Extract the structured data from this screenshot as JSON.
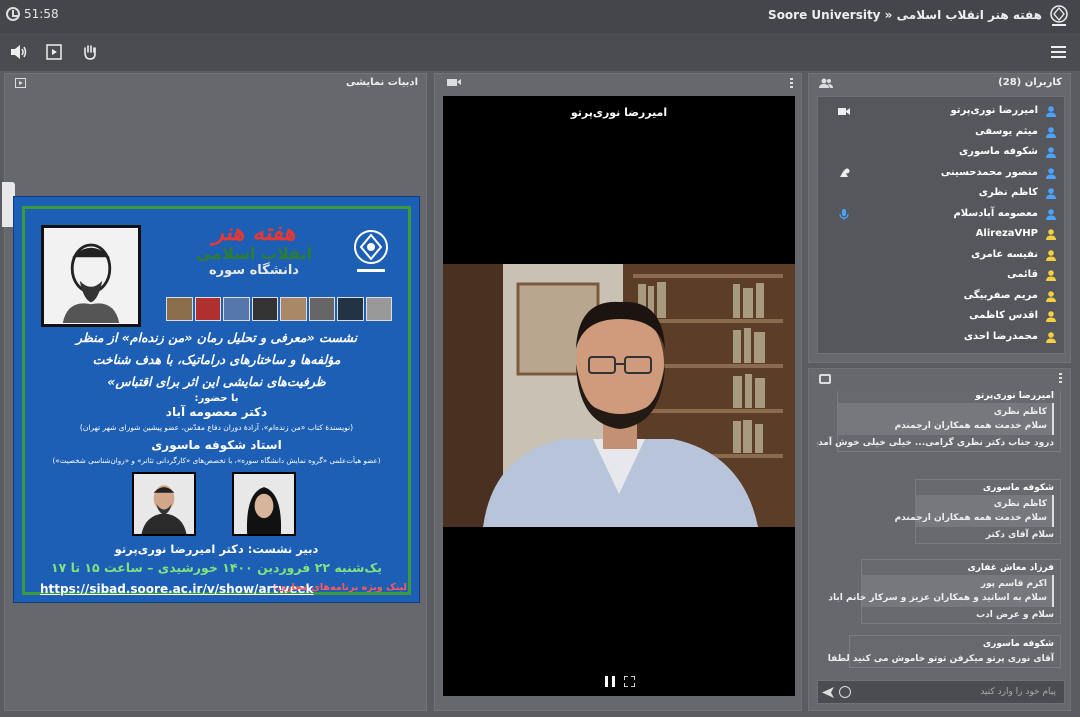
{
  "topbar": {
    "timer": "51:58",
    "title": "Soore University » هفته هنر انقلاب اسلامی"
  },
  "presentation": {
    "title": "ادبیات نمایشی",
    "slide": {
      "festival_line1": "هفته هنر",
      "festival_line2": "انقلاب اسلامی",
      "festival_line3": "دانشگاه سوره",
      "talk_line1": "نشست «معرفی و تحلیل رمان «من زنده‌ام» از منظر",
      "talk_line2": "مؤلفه‌ها و ساختارهای دراماتیک، با هدف شناخت",
      "talk_line3": "ظرفیت‌های نمایشی این اثر برای اقتباس»",
      "with": "با حضور:",
      "guest1": "دکتر معصومه آباد",
      "guest1_desc": "(نویسندهٔ کتاب «من زنده‌ام»، آزادهٔ دوران دفاع مقدّس، عضو پیشین شورای شهر تهران)",
      "guest2": "استاد شکوفه ماسوری",
      "guest2_desc": "(عضو هیأت‌علمی «گروه نمایش دانشگاه سوره»، با تخصص‌های «کارگردانی تئاتر» و «روان‌شناسی شخصیت»)",
      "secretary": "دبیر نشست: دکتر امیررضا نوری‌پرتو",
      "date": "یک‌شنبه ۲۲ فروردین ۱۴۰۰ خورشیدی – ساعت ۱۵ تا ۱۷",
      "url": "https://sibad.soore.ac.ir/v/show/artweek",
      "url_label": "لینک ویژه برنامه‌های مجازی:"
    }
  },
  "video": {
    "speaker": "امیررضا نوری‌پرتو"
  },
  "users": {
    "title": "کاربران (28)",
    "list": [
      {
        "name": "امیررضا نوری‌پرتو",
        "color": "#4aa3ff",
        "status": "camera"
      },
      {
        "name": "میثم یوسفی",
        "color": "#4aa3ff",
        "status": ""
      },
      {
        "name": "شکوفه ماسوری",
        "color": "#4aa3ff",
        "status": ""
      },
      {
        "name": "منصور محمدحسینی",
        "color": "#4aa3ff",
        "status": "presenter"
      },
      {
        "name": "کاظم نظری",
        "color": "#4aa3ff",
        "status": ""
      },
      {
        "name": "معصومه آبادسلام",
        "color": "#4aa3ff",
        "status": "mic"
      },
      {
        "name": "AlirezaVHP",
        "color": "#f3d03e",
        "status": ""
      },
      {
        "name": "نفیسه عامری",
        "color": "#f3d03e",
        "status": ""
      },
      {
        "name": "قائمی",
        "color": "#f3d03e",
        "status": ""
      },
      {
        "name": "مریم صفربیگی",
        "color": "#f3d03e",
        "status": ""
      },
      {
        "name": "اقدس کاظمی",
        "color": "#f3d03e",
        "status": ""
      },
      {
        "name": "محمدرضا احدی",
        "color": "#f3d03e",
        "status": ""
      }
    ]
  },
  "chat": {
    "messages": [
      {
        "who": "امیررضا نوری‌پرتو",
        "quote": [
          "کاظم نظری",
          "سلام خدمت همه همکاران ارجمندم"
        ],
        "lines": [
          "درود جناب دکتر نظری گرامی... خیلی خیلی خوش آمدید..."
        ]
      },
      {
        "who": "شکوفه ماسوری",
        "quote": [
          "کاظم نظری",
          "سلام خدمت همه همکاران ارجمندم"
        ],
        "lines": [
          "سلام آقای دکتر"
        ]
      },
      {
        "who": "فرزاد معاش غفاری",
        "quote": [
          "اکرم قاسم پور",
          "سلام به  اساتید و همکاران عزیز و سرکار خانم اباد"
        ],
        "lines": [
          "سلام و عرض ادب"
        ]
      },
      {
        "who": "شکوفه ماسوری",
        "quote": [],
        "lines": [
          "آقای نوری پرتو میکرفن توتو خاموش می کنید لطفا"
        ]
      }
    ],
    "input_placeholder": "پیام خود را وارد کنید"
  }
}
